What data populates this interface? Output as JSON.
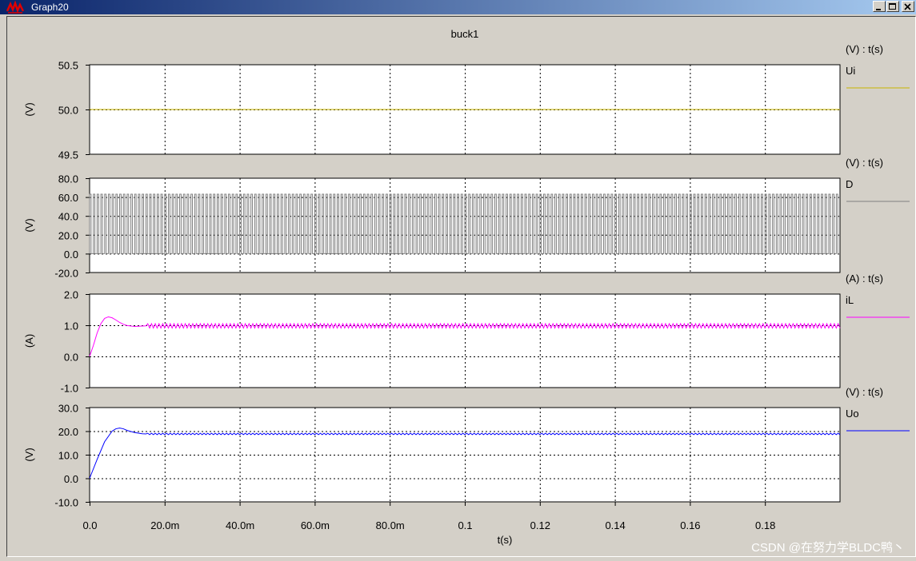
{
  "window": {
    "title": "Graph20",
    "minimize_icon": "minimize-icon",
    "maximize_icon": "maximize-icon",
    "close_icon": "close-icon"
  },
  "chart_data": {
    "type": "line",
    "title": "buck1",
    "xlabel": "t(s)",
    "xlim": [
      0,
      0.2
    ],
    "x_ticks": [
      0,
      0.02,
      0.04,
      0.06,
      0.08,
      0.1,
      0.12,
      0.14,
      0.16,
      0.18
    ],
    "x_tick_labels": [
      "0.0",
      "20.0m",
      "40.0m",
      "60.0m",
      "80.0m",
      "0.1",
      "0.12",
      "0.14",
      "0.16",
      "0.18"
    ],
    "grid": true,
    "panels": [
      {
        "ylabel": "(V)",
        "legend_header": "(V) : t(s)",
        "ylim": [
          49.5,
          50.5
        ],
        "y_ticks": [
          49.5,
          50.0,
          50.5
        ],
        "y_tick_labels": [
          "49.5",
          "50.0",
          "50.5"
        ],
        "series": [
          {
            "name": "Ui",
            "color": "#c8b400",
            "kind": "constant",
            "value": 50.0
          }
        ]
      },
      {
        "ylabel": "(V)",
        "legend_header": "(V) : t(s)",
        "ylim": [
          -20,
          80
        ],
        "y_ticks": [
          -20,
          0,
          20,
          40,
          60,
          80
        ],
        "y_tick_labels": [
          "-20.0",
          "0.0",
          "20.0",
          "40.0",
          "60.0",
          "80.0"
        ],
        "series": [
          {
            "name": "D",
            "color": "#808080",
            "kind": "pwm",
            "low": 0,
            "high": 63,
            "periods": 200,
            "duty": 0.4
          }
        ]
      },
      {
        "ylabel": "(A)",
        "legend_header": "(A) : t(s)",
        "ylim": [
          -1,
          2
        ],
        "y_ticks": [
          -1,
          0,
          1,
          2
        ],
        "y_tick_labels": [
          "-1.0",
          "0.0",
          "1.0",
          "2.0"
        ],
        "series": [
          {
            "name": "iL",
            "color": "#ff00ff",
            "kind": "ripple",
            "steady": 0.98,
            "ripple": 0.07,
            "periods": 200,
            "transient_x": [
              0,
              0.001,
              0.002,
              0.003,
              0.004,
              0.005,
              0.006,
              0.007,
              0.008,
              0.009,
              0.01,
              0.012,
              0.015
            ],
            "transient_y": [
              0,
              0.35,
              0.75,
              1.05,
              1.22,
              1.27,
              1.24,
              1.17,
              1.09,
              1.03,
              0.99,
              0.96,
              0.98
            ]
          }
        ]
      },
      {
        "ylabel": "(V)",
        "legend_header": "(V) : t(s)",
        "ylim": [
          -10,
          30
        ],
        "y_ticks": [
          -10,
          0,
          10,
          20,
          30
        ],
        "y_tick_labels": [
          "-10.0",
          "0.0",
          "10.0",
          "20.0",
          "30.0"
        ],
        "series": [
          {
            "name": "Uo",
            "color": "#0000ff",
            "kind": "ripple",
            "steady": 18.8,
            "ripple": 0.3,
            "periods": 200,
            "transient_x": [
              0,
              0.002,
              0.004,
              0.006,
              0.007,
              0.008,
              0.009,
              0.01,
              0.012,
              0.014,
              0.015
            ],
            "transient_y": [
              0,
              8,
              15.5,
              20,
              21,
              21.3,
              21,
              20.3,
              19.4,
              18.9,
              18.8
            ]
          }
        ]
      }
    ]
  },
  "watermark": "CSDN @在努力学BLDC鸭丶"
}
